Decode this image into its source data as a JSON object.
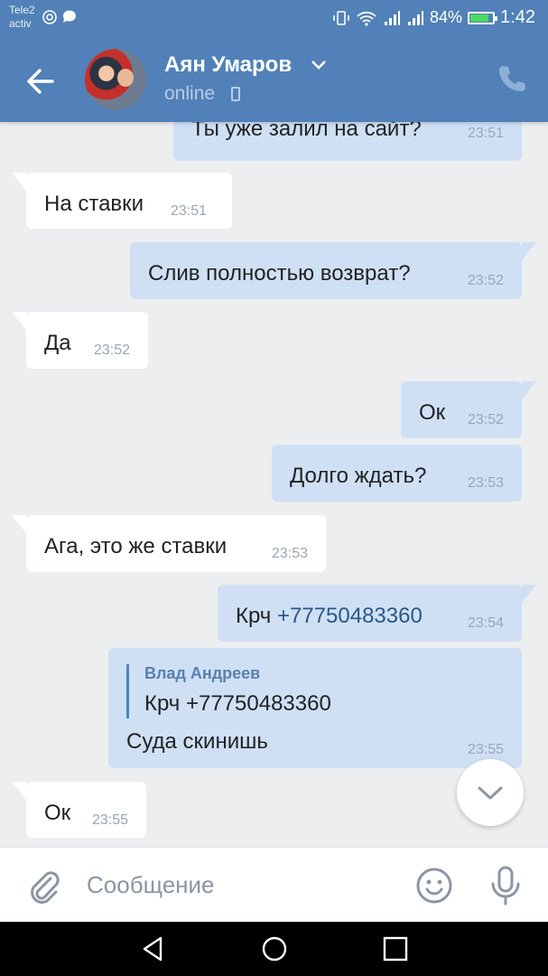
{
  "status_bar": {
    "carrier_line1": "Tele2",
    "carrier_line2": "activ",
    "battery": "84%",
    "time": "1:42"
  },
  "header": {
    "name": "Аян Умаров",
    "presence": "online"
  },
  "messages": [
    {
      "dir": "out",
      "text": "Ты уже залил на сайт?",
      "time": "23:51"
    },
    {
      "dir": "in",
      "text": "На ставки",
      "time": "23:51"
    },
    {
      "dir": "out",
      "text": "Слив полностью возврат?",
      "time": "23:52"
    },
    {
      "dir": "in",
      "text": "Да",
      "time": "23:52"
    },
    {
      "dir": "out",
      "text": "Ок",
      "time": "23:52"
    },
    {
      "dir": "out",
      "text": "Долго ждать?",
      "time": "23:53"
    },
    {
      "dir": "in",
      "text": "Ага, это же ставки",
      "time": "23:53"
    },
    {
      "dir": "out",
      "text_prefix": "Крч ",
      "phone": "+77750483360",
      "time": "23:54"
    },
    {
      "dir": "out",
      "reply_author": "Влад Андреев",
      "reply_text": "Крч +77750483360",
      "text": "Суда скинишь",
      "time": "23:55"
    },
    {
      "dir": "in",
      "text": "Ок",
      "time": "23:55"
    }
  ],
  "composer": {
    "placeholder": "Сообщение"
  },
  "colors": {
    "header": "#5181b8",
    "outgoing_bubble": "#cfe0f5",
    "incoming_bubble": "#ffffff",
    "background": "#edeef0",
    "link": "#2a5885"
  },
  "icons": [
    "back-arrow-icon",
    "chevron-down-icon",
    "mobile-device-icon",
    "phone-call-icon",
    "paperclip-icon",
    "emoji-icon",
    "microphone-icon",
    "nav-back-icon",
    "nav-home-icon",
    "nav-recents-icon"
  ]
}
